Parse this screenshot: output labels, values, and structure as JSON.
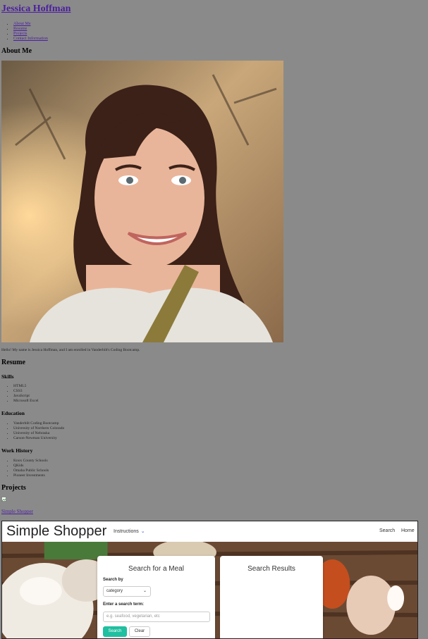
{
  "site": {
    "title": "Jessica Hoffman"
  },
  "nav": {
    "items": [
      "About Me",
      "Resume",
      "Projects",
      "Contact Information"
    ]
  },
  "about": {
    "heading": "About Me",
    "bio": "Hello! My name is Jessica Hoffman, and I am enrolled in Vanderbilt's Coding Bootcamp."
  },
  "resume": {
    "heading": "Resume",
    "skills": {
      "heading": "Skills",
      "items": [
        "HTML5",
        "CSS3",
        "JavaScript",
        "Microsoft Excel"
      ]
    },
    "education": {
      "heading": "Education",
      "items": [
        "Vanderbilt Coding Bootcamp",
        "University of Northern Colorado",
        "University of Nebraska",
        "Carson-Newman University"
      ]
    },
    "work": {
      "heading": "Work History",
      "items": [
        "Knox County Schools",
        "QKids",
        "Omaha Public Schools",
        "Pioneer Investments"
      ]
    }
  },
  "projects": {
    "heading": "Projects",
    "link_label": "Simple Shopper",
    "screenshot": {
      "brand": "Simple Shopper",
      "instructions": "Instructions",
      "nav_search": "Search",
      "nav_home": "Home",
      "search_card_title": "Search for a Meal",
      "search_by_label": "Search by",
      "search_by_value": "category",
      "term_label": "Enter a search term:",
      "term_placeholder": "e.g. seafood, vegetarian, etc",
      "search_button": "Search",
      "clear_button": "Clear",
      "results_title": "Search Results",
      "accent": "#1fbfa0"
    }
  },
  "colors": {
    "link": "#4b1f9e",
    "page_bg": "#8a8a8a"
  }
}
